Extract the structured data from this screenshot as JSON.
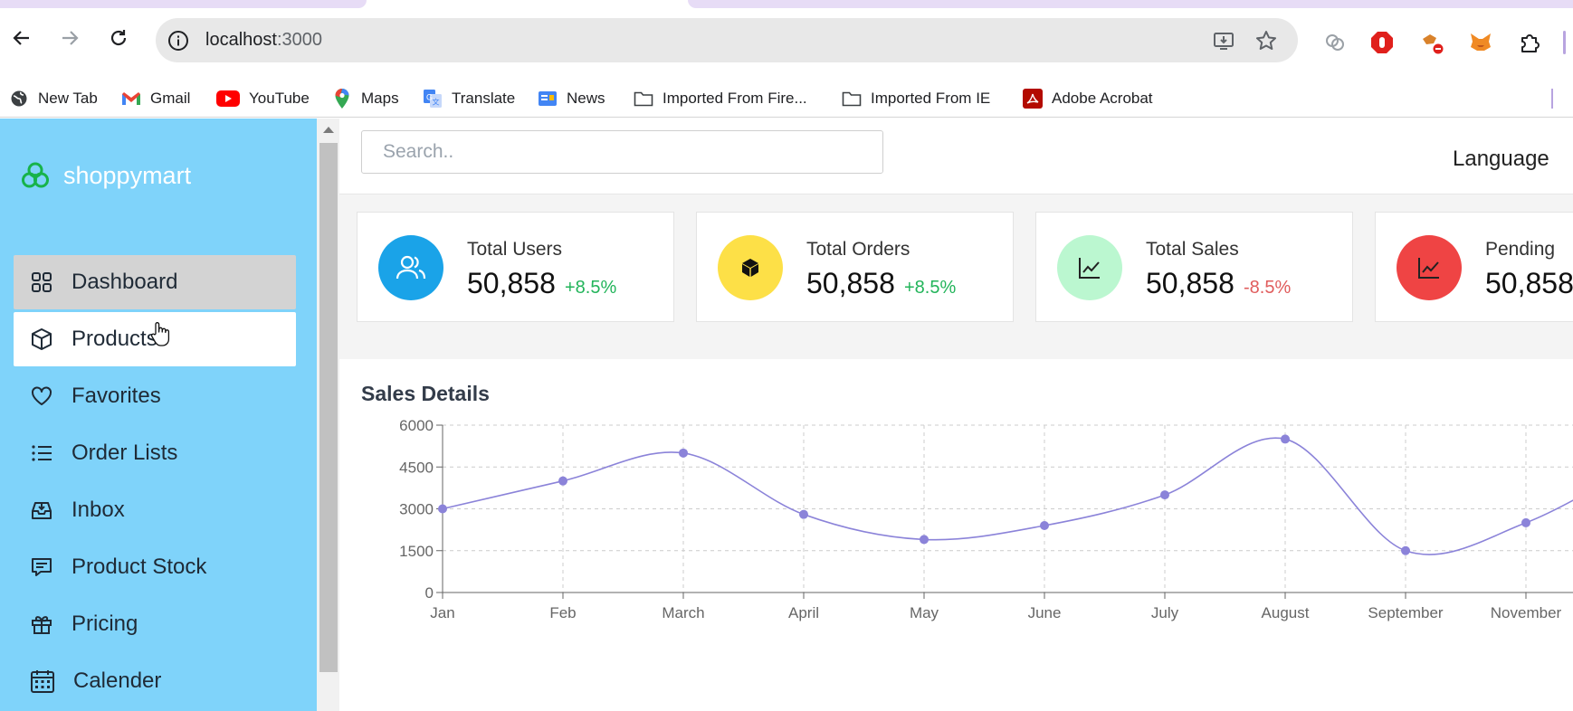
{
  "browser": {
    "url_host": "localhost",
    "url_port": ":3000",
    "bookmarks": [
      {
        "label": "New Tab",
        "icon": "globe-icon"
      },
      {
        "label": "Gmail",
        "icon": "gmail-icon"
      },
      {
        "label": "YouTube",
        "icon": "youtube-icon"
      },
      {
        "label": "Maps",
        "icon": "maps-icon"
      },
      {
        "label": "Translate",
        "icon": "translate-icon"
      },
      {
        "label": "News",
        "icon": "news-icon"
      },
      {
        "label": "Imported From Fire...",
        "icon": "folder-icon"
      },
      {
        "label": "Imported From IE",
        "icon": "folder-icon"
      },
      {
        "label": "Adobe Acrobat",
        "icon": "acrobat-icon"
      }
    ]
  },
  "sidebar": {
    "brand": "shoppymart",
    "items": [
      {
        "label": "Dashboard",
        "icon": "grid-icon",
        "state": "active"
      },
      {
        "label": "Products",
        "icon": "box-icon",
        "state": "hover"
      },
      {
        "label": "Favorites",
        "icon": "heart-icon",
        "state": "normal"
      },
      {
        "label": "Order Lists",
        "icon": "list-icon",
        "state": "normal"
      },
      {
        "label": "Inbox",
        "icon": "inbox-icon",
        "state": "normal"
      },
      {
        "label": "Product Stock",
        "icon": "message-icon",
        "state": "normal"
      },
      {
        "label": "Pricing",
        "icon": "gift-icon",
        "state": "normal"
      },
      {
        "label": "Calender",
        "icon": "calendar-icon",
        "state": "normal"
      }
    ]
  },
  "topbar": {
    "search_placeholder": "Search..",
    "language": "Language"
  },
  "stats": [
    {
      "label": "Total Users",
      "value": "50,858",
      "trend": "+8.5%",
      "direction": "up",
      "color": "#1aa3e8",
      "icon": "users-icon"
    },
    {
      "label": "Total Orders",
      "value": "50,858",
      "trend": "+8.5%",
      "direction": "up",
      "color": "#fde047",
      "icon": "cube-icon"
    },
    {
      "label": "Total Sales",
      "value": "50,858",
      "trend": "-8.5%",
      "direction": "down",
      "color": "#bbf7d0",
      "icon": "chart-line-icon"
    },
    {
      "label": "Pending",
      "value": "50,858",
      "trend": "",
      "direction": "",
      "color": "#ef4444",
      "icon": "chart-line-icon"
    }
  ],
  "sales": {
    "title": "Sales Details"
  },
  "chart_data": {
    "type": "line",
    "title": "Sales Details",
    "categories": [
      "Jan",
      "Feb",
      "March",
      "April",
      "May",
      "June",
      "July",
      "August",
      "September",
      "November"
    ],
    "series": [
      {
        "values": [
          3000,
          4000,
          5000,
          2800,
          1900,
          2400,
          3500,
          5500,
          1500,
          2500
        ]
      }
    ],
    "ylim": [
      0,
      6000
    ],
    "yticks": [
      0,
      1500,
      3000,
      4500,
      6000
    ],
    "grid": true,
    "color": "#8b83d9"
  }
}
